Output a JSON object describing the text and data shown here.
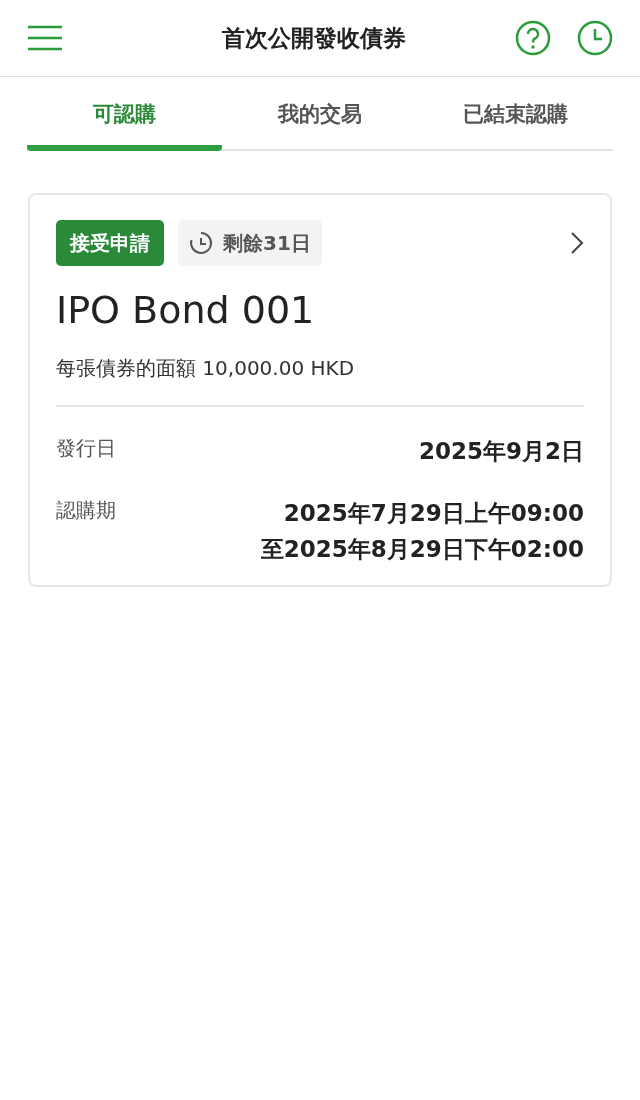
{
  "header": {
    "title": "首次公開發收債券"
  },
  "tabs": [
    {
      "label": "可認購",
      "selected": true
    },
    {
      "label": "我的交易",
      "selected": false
    },
    {
      "label": "已結束認購",
      "selected": false
    }
  ],
  "card": {
    "status": "接受申請",
    "remaining": "剩餘31日",
    "name": "IPO Bond 001",
    "denomination": "每張債券的面額 10,000.00 HKD",
    "details": [
      {
        "label": "發行日",
        "value_lines": [
          "2025年9月2日"
        ]
      },
      {
        "label": "認購期",
        "value_lines": [
          "2025年7月29日上午09:00",
          "至2025年8月29日下午02:00"
        ]
      }
    ]
  }
}
